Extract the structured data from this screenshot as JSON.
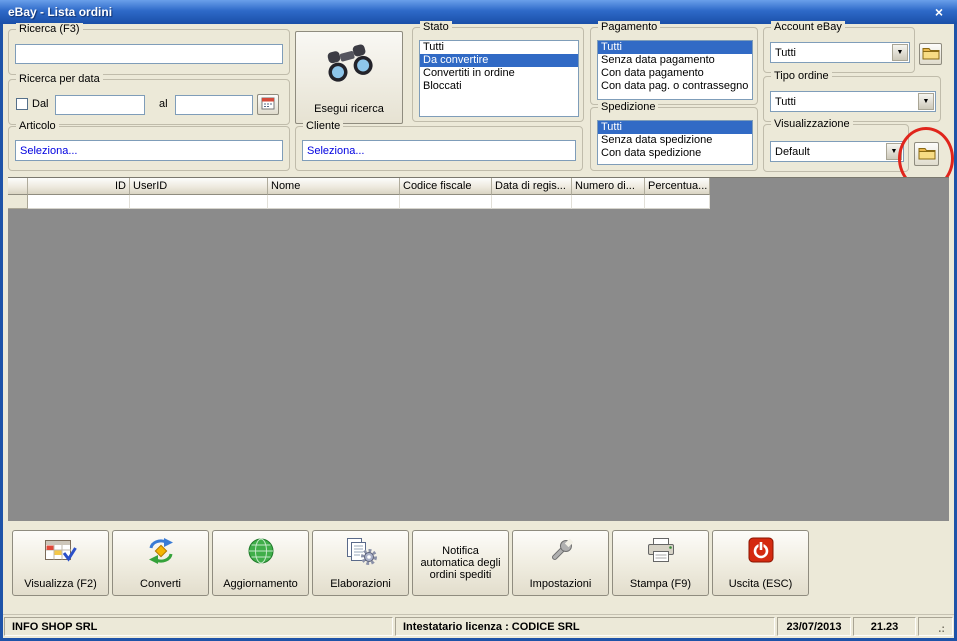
{
  "window": {
    "title": "eBay - Lista ordini"
  },
  "glyphs": {
    "close": "×",
    "dropdown": "▼",
    "resize_grip": ".:"
  },
  "filters": {
    "ricerca": {
      "label": "Ricerca (F3)",
      "value": ""
    },
    "ricerca_per_data": {
      "label": "Ricerca per data",
      "dal": "Dal",
      "al": "al",
      "dal_value": "",
      "al_value": ""
    },
    "articolo": {
      "label": "Articolo",
      "value": "Seleziona..."
    },
    "cliente": {
      "label": "Cliente",
      "value": "Seleziona..."
    },
    "esegui_ricerca": "Esegui ricerca",
    "stato": {
      "label": "Stato",
      "items": [
        "Tutti",
        "Da convertire",
        "Convertiti in ordine",
        "Bloccati"
      ],
      "selected": "Da convertire"
    },
    "pagamento": {
      "label": "Pagamento",
      "items": [
        "Tutti",
        "Senza data pagamento",
        "Con data pagamento",
        "Con data pag. o contrassegno"
      ],
      "selected": "Tutti"
    },
    "spedizione": {
      "label": "Spedizione",
      "items": [
        "Tutti",
        "Senza data spedizione",
        "Con data spedizione"
      ],
      "selected": "Tutti"
    },
    "account_ebay": {
      "label": "Account eBay",
      "value": "Tutti"
    },
    "tipo_ordine": {
      "label": "Tipo ordine",
      "value": "Tutti"
    },
    "visualizzazione": {
      "label": "Visualizzazione",
      "value": "Default"
    }
  },
  "table": {
    "columns": [
      "ID",
      "UserID",
      "Nome",
      "Codice fiscale",
      "Data di regis...",
      "Numero di...",
      "Percentua..."
    ]
  },
  "toolbar": {
    "buttons": [
      {
        "label": "Visualizza (F2)",
        "icon": "table-view-icon"
      },
      {
        "label": "Converti",
        "icon": "convert-arrows-icon"
      },
      {
        "label": "Aggiornamento",
        "icon": "globe-icon"
      },
      {
        "label": "Elaborazioni",
        "icon": "documents-gear-icon"
      },
      {
        "label": "Notifica automatica degli ordini spediti",
        "icon": ""
      },
      {
        "label": "Impostazioni",
        "icon": "wrench-icon"
      },
      {
        "label": "Stampa (F9)",
        "icon": "printer-icon"
      },
      {
        "label": "Uscita (ESC)",
        "icon": "power-icon"
      }
    ]
  },
  "statusbar": {
    "company": "INFO SHOP SRL",
    "license": "Intestatario licenza : CODICE SRL",
    "date": "23/07/2013",
    "time": "21.23"
  },
  "annotation": {
    "shape": "ellipse",
    "color": "#e0251c",
    "target": "visualizzazione-folder-button"
  }
}
